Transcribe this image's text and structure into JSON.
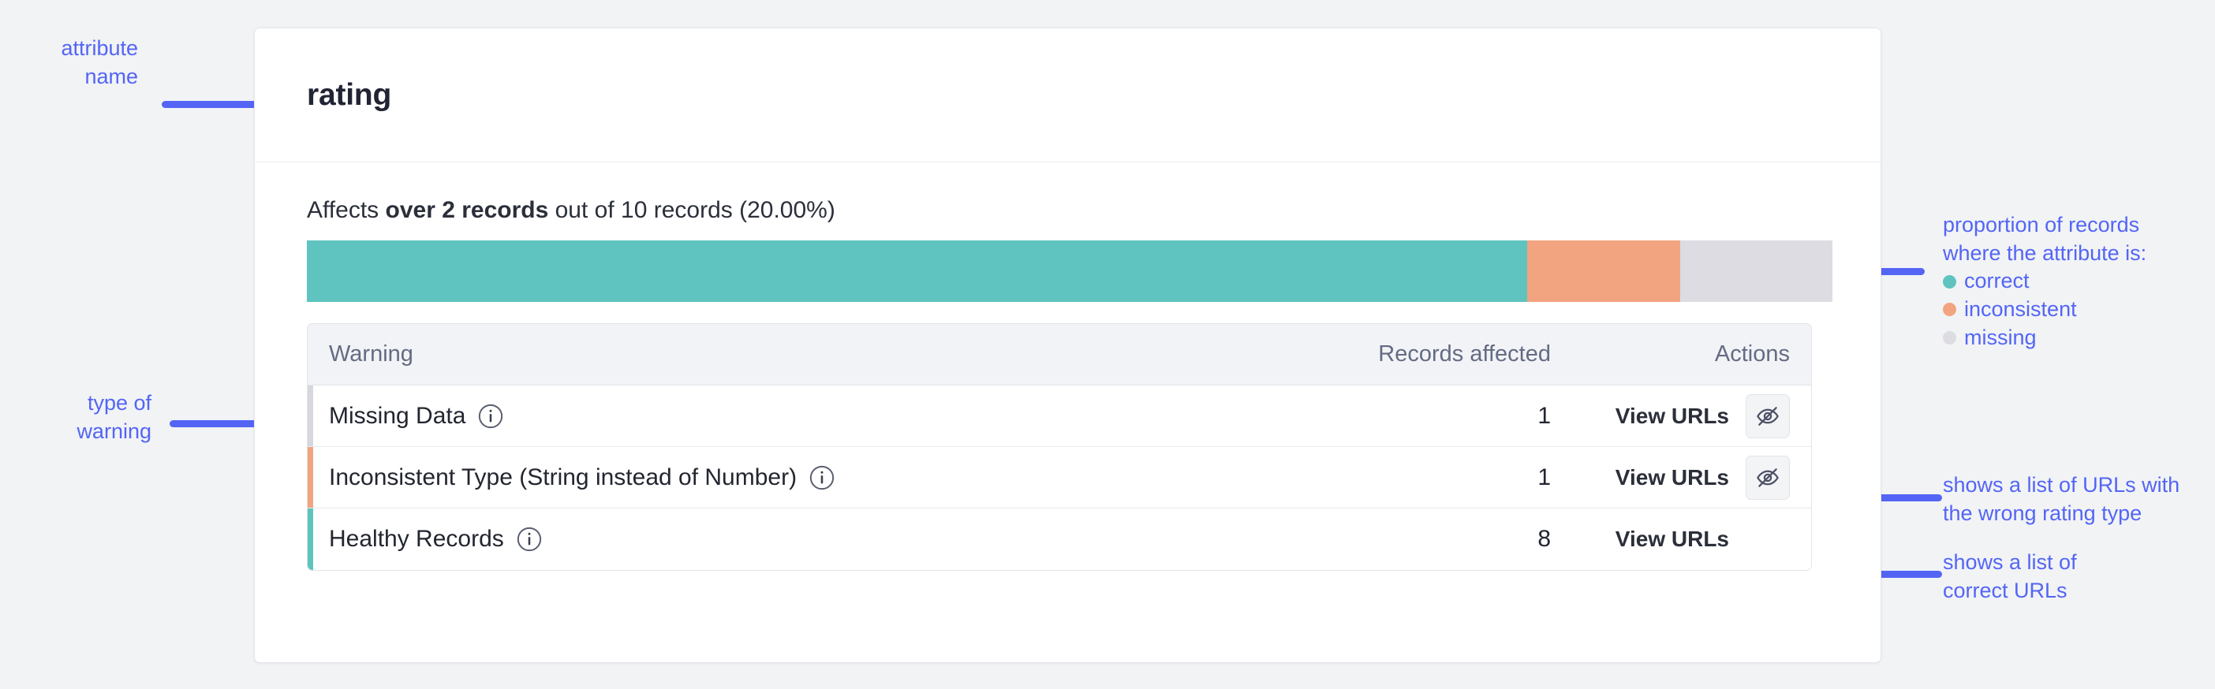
{
  "card": {
    "title": "rating",
    "affects": {
      "prefix": "Affects ",
      "bold": "over 2 records",
      "suffix": " out of 10 records (20.00%)"
    },
    "bar": {
      "segments": [
        {
          "name": "correct",
          "color": "#5fc4c0",
          "percent": 80
        },
        {
          "name": "inconsistent",
          "color": "#f2a480",
          "percent": 10
        },
        {
          "name": "missing",
          "color": "#dcdce2",
          "percent": 10
        }
      ]
    },
    "table": {
      "columns": [
        "Warning",
        "Records affected",
        "Actions"
      ],
      "rows": [
        {
          "warning": "Missing Data",
          "info_icon": "info-circle-icon",
          "records": "1",
          "action_label": "View URLs",
          "toggle_icon": "eye-slash-icon",
          "has_toggle": true,
          "accent": "#d6d8de"
        },
        {
          "warning": "Inconsistent Type (String instead of Number)",
          "info_icon": "info-circle-icon",
          "records": "1",
          "action_label": "View URLs",
          "toggle_icon": "eye-slash-icon",
          "has_toggle": true,
          "accent": "#f2a480"
        },
        {
          "warning": "Healthy Records",
          "info_icon": "info-circle-icon",
          "records": "8",
          "action_label": "View URLs",
          "toggle_icon": "eye-slash-icon",
          "has_toggle": false,
          "accent": "#5fc4c0"
        }
      ]
    }
  },
  "annotations": {
    "color": "#5465f5",
    "attribute_name": {
      "line1": "attribute",
      "line2": "name"
    },
    "type_of_warning": {
      "line1": "type of",
      "line2": "warning"
    },
    "proportion": {
      "line1": "proportion of records",
      "line2": "where the attribute is:",
      "legend": [
        {
          "label": "correct",
          "color": "#5fc4c0"
        },
        {
          "label": "inconsistent",
          "color": "#f2a480"
        },
        {
          "label": "missing",
          "color": "#dcdce2"
        }
      ]
    },
    "wrong_urls": {
      "line1": "shows a list of URLs with",
      "line2": "the wrong rating type"
    },
    "correct_urls": {
      "line1": "shows a list of",
      "line2": "correct URLs"
    }
  }
}
